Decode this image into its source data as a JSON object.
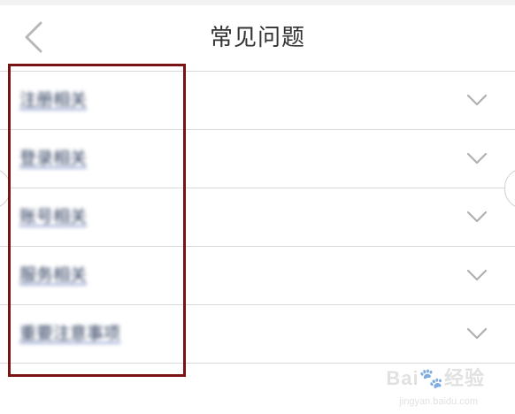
{
  "header": {
    "title": "常见问题"
  },
  "faq": {
    "items": [
      {
        "label": "注册相关"
      },
      {
        "label": "登录相关"
      },
      {
        "label": "账号相关"
      },
      {
        "label": "服务相关"
      },
      {
        "label": "重要注意事项"
      }
    ]
  },
  "watermark": {
    "logo_text": "Bai🐾经验",
    "sub_text": "jingyan.baidu.com"
  },
  "colors": {
    "highlight_border": "#7a1414",
    "divider": "#d9d9d9",
    "title_text": "#333333",
    "chevron": "#b0b0b0"
  },
  "icons": {
    "back": "chevron-left-icon",
    "expand": "chevron-down-icon"
  }
}
